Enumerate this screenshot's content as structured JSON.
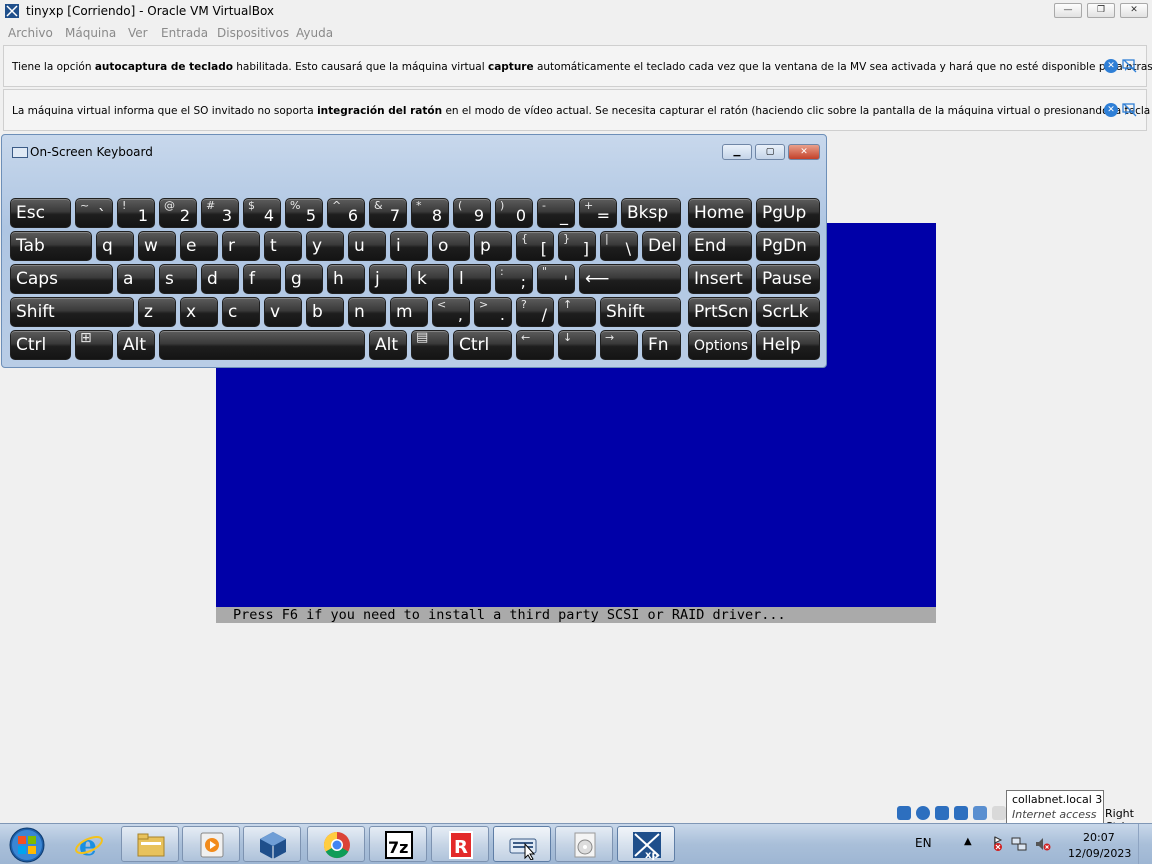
{
  "window": {
    "title": "tinyxp [Corriendo] - Oracle VM VirtualBox",
    "controls": {
      "minimize": "—",
      "restore": "❐",
      "close": "✕"
    }
  },
  "menu": [
    "Archivo",
    "Máquina",
    "Ver",
    "Entrada",
    "Dispositivos",
    "Ayuda"
  ],
  "banners": [
    {
      "pre": "Tiene la opción ",
      "bold1": "autocaptura de teclado",
      "mid": " habilitada. Esto causará que la máquina virtual ",
      "bold2": "capture",
      "post": " automáticamente el teclado cada vez que la ventana de la MV sea activada y hará que no esté disponible para otras"
    },
    {
      "pre": "La máquina virtual informa que el SO invitado no soporta ",
      "bold1": "integración del ratón",
      "mid": " en el modo de vídeo actual. Se necesita capturar el ratón (haciendo clic sobre la pantalla de la máquina virtual o presionando la tecla anfitrión)",
      "bold2": "",
      "post": ""
    }
  ],
  "vm": {
    "screen_color": "#0000a8",
    "status_text": "Press F6 if you need to install a third party SCSI or RAID driver..."
  },
  "osk": {
    "title": "On-Screen Keyboard",
    "controls": {
      "minimize": "▁",
      "restore": "▢",
      "close": "✕"
    },
    "keys": {
      "esc": "Esc",
      "tilde_s": "~",
      "tilde_b": "`",
      "n1_s": "!",
      "n1": "1",
      "n2_s": "@",
      "n2": "2",
      "n3_s": "#",
      "n3": "3",
      "n4_s": "$",
      "n4": "4",
      "n5_s": "%",
      "n5": "5",
      "n6_s": "^",
      "n6": "6",
      "n7_s": "&",
      "n7": "7",
      "n8_s": "*",
      "n8": "8",
      "n9_s": "(",
      "n9": "9",
      "n0_s": ")",
      "n0": "0",
      "minus_s": "-",
      "minus": "_",
      "eq_s": "+",
      "eq": "=",
      "bksp": "Bksp",
      "home": "Home",
      "pgup": "PgUp",
      "tab": "Tab",
      "q": "q",
      "w": "w",
      "e": "e",
      "r": "r",
      "t": "t",
      "y": "y",
      "u": "u",
      "i": "i",
      "o": "o",
      "p": "p",
      "lbr_s": "{",
      "lbr": "[",
      "rbr_s": "}",
      "rbr": "]",
      "bs_s": "|",
      "bs": "\\",
      "del": "Del",
      "end": "End",
      "pgdn": "PgDn",
      "caps": "Caps",
      "a": "a",
      "s": "s",
      "d": "d",
      "f": "f",
      "g": "g",
      "h": "h",
      "j": "j",
      "k": "k",
      "l": "l",
      "semi_s": ":",
      "semi": ";",
      "quote_s": "\"",
      "quote": "'",
      "enter": "⟵",
      "insert": "Insert",
      "pause": "Pause",
      "lshift": "Shift",
      "z": "z",
      "x": "x",
      "c": "c",
      "v": "v",
      "b": "b",
      "n": "n",
      "m": "m",
      "comma_s": "<",
      "comma": ",",
      "dot_s": ">",
      "dot": ".",
      "slash_s": "?",
      "slash": "/",
      "up": "↑",
      "rshift": "Shift",
      "prtscn": "PrtScn",
      "scrlk": "ScrLk",
      "lctrl": "Ctrl",
      "win": "⊞",
      "lalt": "Alt",
      "space": "",
      "ralt": "Alt",
      "menu": "▤",
      "rctrl": "Ctrl",
      "left": "←",
      "down": "↓",
      "right": "→",
      "fn": "Fn",
      "options": "Options",
      "help": "Help"
    }
  },
  "status_area": {
    "tooltip_line1": "collabnet.local  3",
    "tooltip_line2": "Internet access",
    "host_key": "Right Ctrl"
  },
  "taskbar": {
    "apps": [
      "start-button",
      "internet-explorer",
      "file-explorer",
      "media-player",
      "virtualbox",
      "chrome",
      "7-zip",
      "roblox",
      "on-screen-keyboard",
      "media-disc",
      "virtualbox-xp"
    ],
    "lang": "EN",
    "tray_arrow": "▲",
    "time": "20:07",
    "date": "12/09/2023"
  }
}
